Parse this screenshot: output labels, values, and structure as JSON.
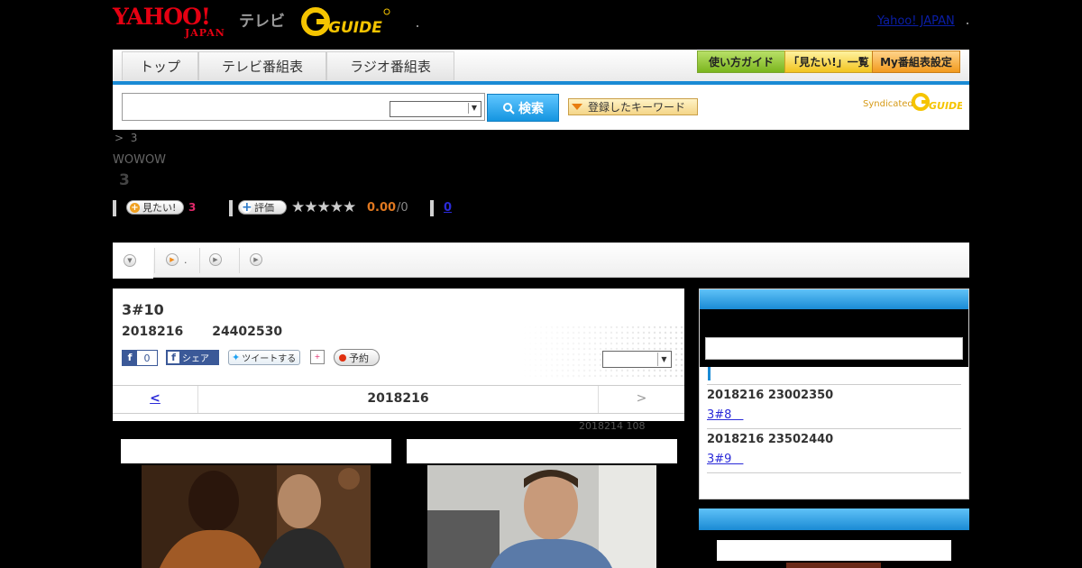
{
  "header": {
    "yahoo_logo_text": "YAHOO!",
    "yahoo_logo_sub": "JAPAN",
    "tv_label": "テレビ",
    "gguide_logo_text": "GUIDE",
    "yahoo_japan_link": "Yahoo! JAPAN"
  },
  "nav": {
    "tabs": [
      {
        "label": "トップ"
      },
      {
        "label": "テレビ番組表"
      },
      {
        "label": "ラジオ番組表"
      }
    ],
    "buttons": [
      {
        "label": "使い方ガイド"
      },
      {
        "label": "「見たい!」一覧"
      },
      {
        "label": "My番組表設定"
      }
    ]
  },
  "search": {
    "input_value": "",
    "select_value": "",
    "button_label": "検索",
    "keyword_button_label": "登録したキーワード",
    "syndicated_text": "Syndicated"
  },
  "program": {
    "breadcrumb_sep": ">",
    "breadcrumb_item": "3",
    "channel": "WOWOW",
    "title": "3",
    "want_label": "見たい!",
    "want_count": "3",
    "rate_label": "評価",
    "stars": "★★★★★",
    "rating": "0.00",
    "rating_count": "/0",
    "review_count": "0"
  },
  "tabs": {
    "tab2_suffix": "."
  },
  "episode": {
    "title": "3#10",
    "date": "2018216",
    "time": "24402530",
    "fb_like_label": "f",
    "fb_count": "0",
    "fb_share_label": "シェア",
    "tweet_label": "ツイートする",
    "reserve_label": "予約",
    "select_value": "",
    "date_nav": {
      "prev": "<",
      "current": "2018216",
      "next": ">"
    },
    "broadcast_note": "2018214  108"
  },
  "sidebar": {
    "items": [
      {
        "time": "2018216  23002350",
        "title": "3#8　"
      },
      {
        "time": "2018216  23502440",
        "title": "3#9　"
      }
    ]
  },
  "colors": {
    "accent_blue": "#1a8ad4",
    "yahoo_red": "#e60012",
    "guide_yellow": "#f5c400"
  }
}
